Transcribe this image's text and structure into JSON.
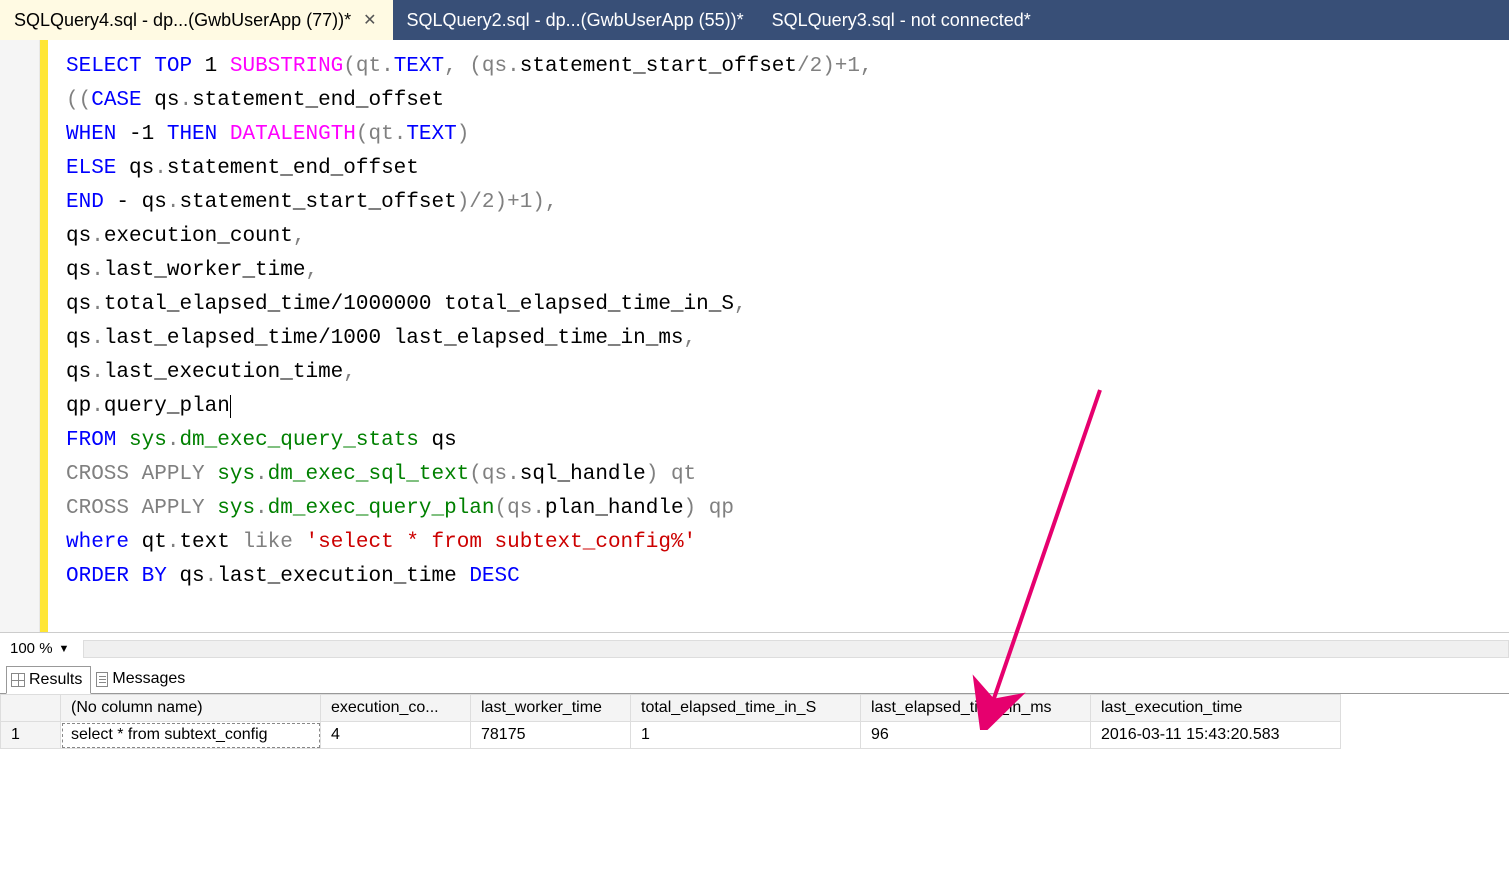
{
  "tabs": [
    {
      "label": "SQLQuery4.sql - dp...(GwbUserApp (77))*",
      "active": true,
      "closable": true
    },
    {
      "label": "SQLQuery2.sql - dp...(GwbUserApp (55))*",
      "active": false,
      "closable": false
    },
    {
      "label": "SQLQuery3.sql - not connected*",
      "active": false,
      "closable": false
    }
  ],
  "zoom": {
    "value": "100 %"
  },
  "result_tabs": {
    "results": "Results",
    "messages": "Messages"
  },
  "sql": {
    "l1_select": "SELECT",
    "l1_top": "TOP",
    "l1_one": " 1 ",
    "l1_substr": "SUBSTRING",
    "l1_tail1": "(qt",
    "l1_text": "TEXT",
    "l1_tail2": ", (qs",
    "l1_ident1": "statement_start_offset",
    "l1_tail3": "/2)+1,",
    "l2_a": "((",
    "l2_case": "CASE",
    "l2_b": " qs",
    "l2_ident": "statement_end_offset",
    "l3_when": "WHEN",
    "l3_mid": " -1 ",
    "l3_then": "THEN",
    "l3_dl": "DATALENGTH",
    "l3_a": "(qt",
    "l3_text": "TEXT",
    "l3_b": ")",
    "l4_else": "ELSE",
    "l4_a": " qs",
    "l4_ident": "statement_end_offset",
    "l5_end": "END",
    "l5_a": " - qs",
    "l5_ident": "statement_start_offset",
    "l5_b": ")/2)+1),",
    "l6_a": "qs",
    "l6_ident": "execution_count",
    "l6_b": ",",
    "l7_a": "qs",
    "l7_ident": "last_worker_time",
    "l7_b": ",",
    "l8_a": "qs",
    "l8_ident": "total_elapsed_time",
    "l8_mid": "/1000000 total_elapsed_time_in_S",
    "l8_b": ",",
    "l9_a": "qs",
    "l9_ident": "last_elapsed_time",
    "l9_mid": "/1000 last_elapsed_time_in_ms",
    "l9_b": ",",
    "l10_a": "qs",
    "l10_ident": "last_execution_time",
    "l10_b": ",",
    "l11_a": "qp",
    "l11_ident": "query_plan",
    "l12_from": "FROM",
    "l12_sys": "sys",
    "l12_obj": "dm_exec_query_stats",
    "l12_alias": " qs",
    "l13_ca": "CROSS APPLY ",
    "l13_sys": "sys",
    "l13_fn": "dm_exec_sql_text",
    "l13_a": "(qs",
    "l13_ident": "sql_handle",
    "l13_b": ") qt",
    "l14_ca": "CROSS APPLY ",
    "l14_sys": "sys",
    "l14_fn": "dm_exec_query_plan",
    "l14_a": "(qs",
    "l14_ident": "plan_handle",
    "l14_b": ") qp",
    "l15_where": "where",
    "l15_a": " qt",
    "l15_text": "text",
    "l15_like": "like",
    "l15_str": "'select * from subtext_config%'",
    "l16_order": "ORDER",
    "l16_by": "BY",
    "l16_a": " qs",
    "l16_ident": "last_execution_time",
    "l16_desc": "DESC"
  },
  "results": {
    "headers": [
      "",
      "(No column name)",
      "execution_co...",
      "last_worker_time",
      "total_elapsed_time_in_S",
      "last_elapsed_time_in_ms",
      "last_execution_time"
    ],
    "rows": [
      {
        "n": "1",
        "c0": "select * from subtext_config",
        "c1": "4",
        "c2": "78175",
        "c3": "1",
        "c4": "96",
        "c5": "2016-03-11 15:43:20.583"
      }
    ]
  }
}
